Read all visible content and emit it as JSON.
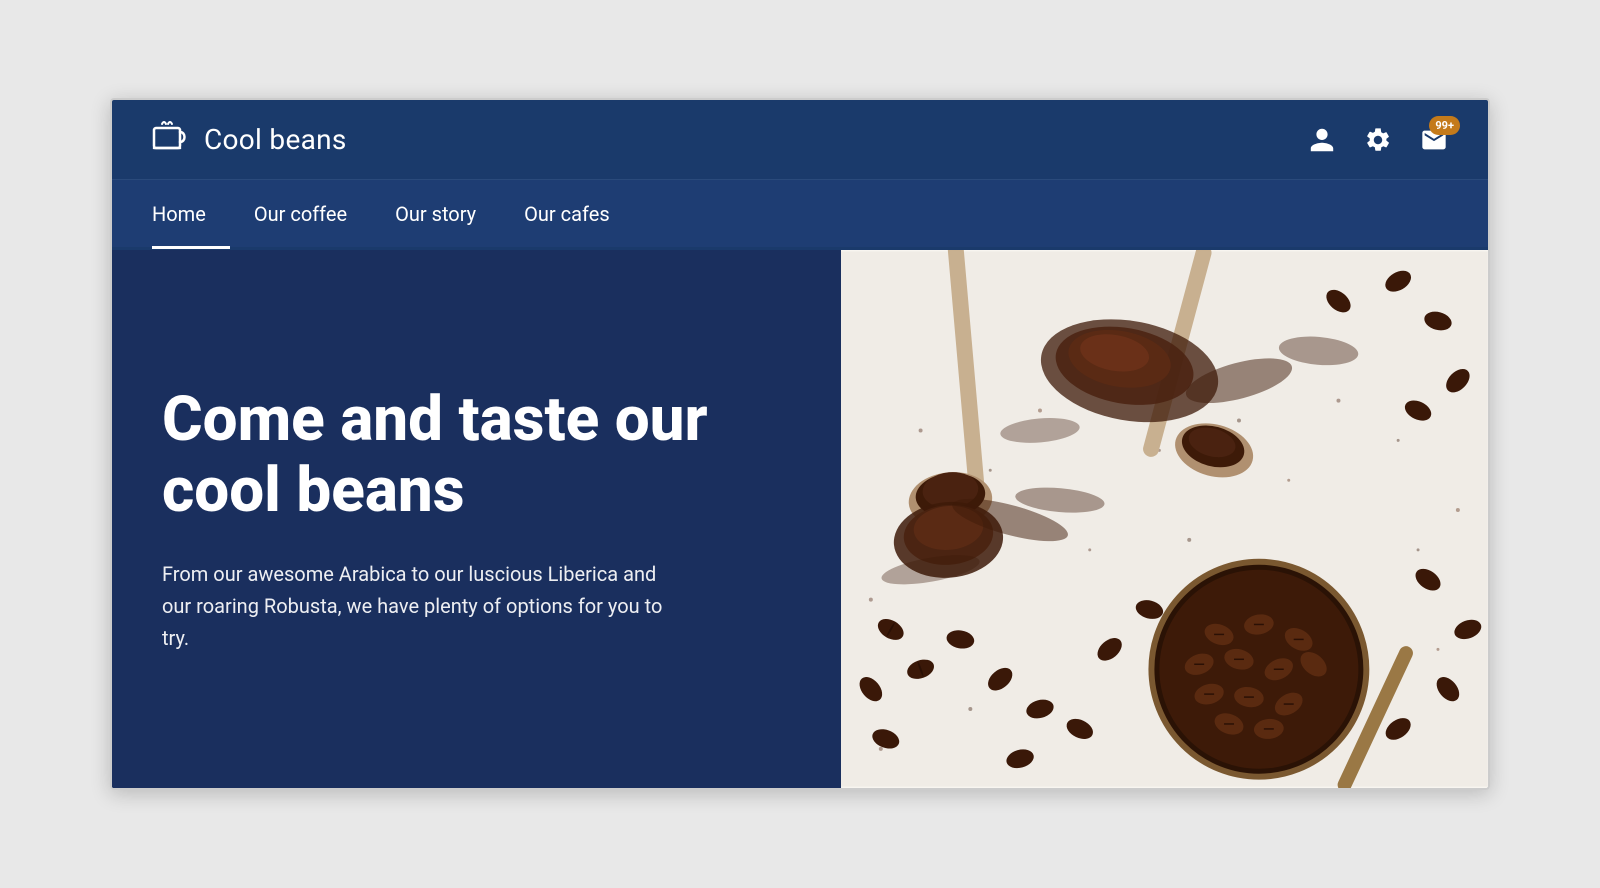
{
  "header": {
    "logo_icon": "☕",
    "logo_text": "Cool beans",
    "icons": {
      "user_icon": "user",
      "settings_icon": "settings",
      "mail_icon": "mail",
      "notification_count": "99+"
    }
  },
  "nav": {
    "items": [
      {
        "label": "Home",
        "active": true
      },
      {
        "label": "Our coffee",
        "active": false
      },
      {
        "label": "Our story",
        "active": false
      },
      {
        "label": "Our cafes",
        "active": false
      }
    ]
  },
  "hero": {
    "title": "Come and taste our cool beans",
    "subtitle": "From our awesome Arabica to our luscious Liberica and our roaring Robusta, we have plenty of options for you to try.",
    "accent_color": "#1a2f5e",
    "badge_color": "#c47a1a"
  }
}
